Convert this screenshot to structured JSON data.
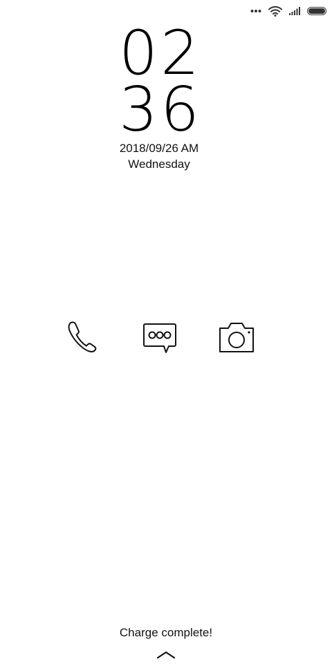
{
  "status_bar": {
    "icons": [
      "more-dots-icon",
      "wifi-icon",
      "signal-icon",
      "battery-icon"
    ]
  },
  "clock": {
    "hours": "02",
    "minutes": "36"
  },
  "date": {
    "full": "2018/09/26 AM",
    "weekday": "Wednesday"
  },
  "shortcuts": [
    {
      "name": "phone",
      "icon": "phone-icon"
    },
    {
      "name": "messages",
      "icon": "message-icon"
    },
    {
      "name": "camera",
      "icon": "camera-icon"
    }
  ],
  "status_message": "Charge complete!",
  "unlock_hint_icon": "chevron-up-icon"
}
